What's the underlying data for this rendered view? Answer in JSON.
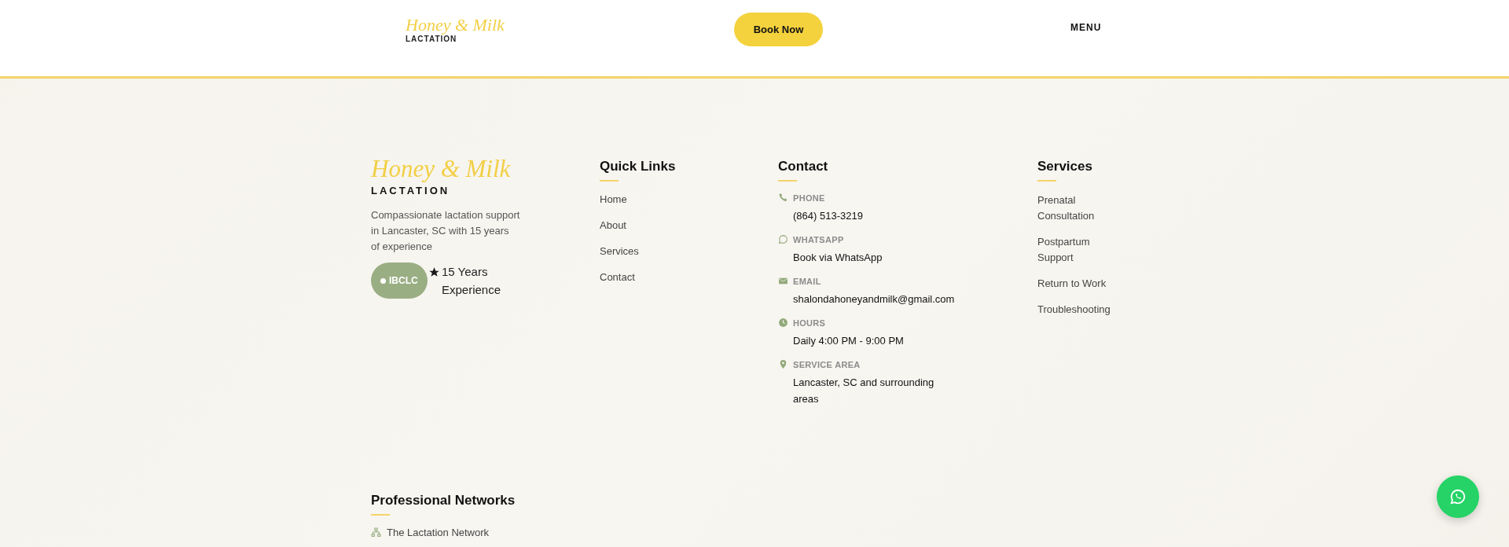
{
  "header": {
    "logo": {
      "script": "Honey & Milk",
      "sub": "LACTATION"
    },
    "book_button": "Book Now",
    "menu": "MENU"
  },
  "footer": {
    "brand": {
      "script": "Honey & Milk",
      "sub": "LACTATION",
      "description": "Compassionate lactation support in Lancaster, SC with 15 years of experience",
      "badge": "IBCLC",
      "experience": "15 Years Experience"
    },
    "quick_links": {
      "title": "Quick Links",
      "items": [
        "Home",
        "About",
        "Services",
        "Contact"
      ]
    },
    "contact": {
      "title": "Contact",
      "items": [
        {
          "kind": "phone",
          "label": "PHONE",
          "value": "(864) 513-3219"
        },
        {
          "kind": "whatsapp",
          "label": "WHATSAPP",
          "value": "Book via WhatsApp"
        },
        {
          "kind": "email",
          "label": "EMAIL",
          "value": "shalondahoneyandmilk@gmail.com"
        },
        {
          "kind": "hours",
          "label": "HOURS",
          "value": "Daily 4:00 PM - 9:00 PM"
        },
        {
          "kind": "location",
          "label": "SERVICE AREA",
          "value": "Lancaster, SC and surrounding areas"
        }
      ]
    },
    "services": {
      "title": "Services",
      "items": [
        "Prenatal Consultation",
        "Postpartum Support",
        "Return to Work",
        "Troubleshooting"
      ]
    },
    "networks": {
      "title": "Professional Networks",
      "items": [
        "The Lactation Network"
      ]
    }
  }
}
